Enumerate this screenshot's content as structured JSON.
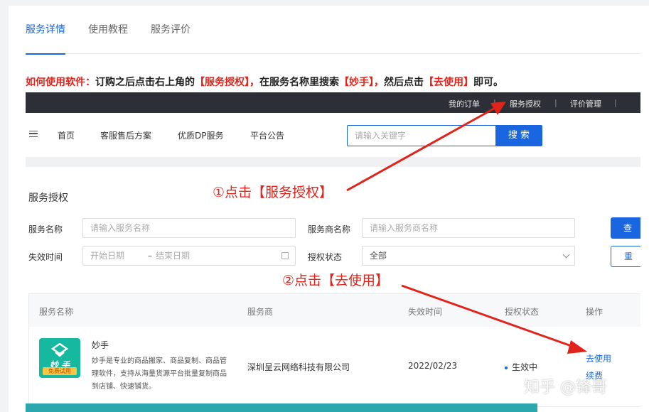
{
  "tabs": [
    {
      "label": "服务详情",
      "active": true
    },
    {
      "label": "使用教程",
      "active": false
    },
    {
      "label": "服务评价",
      "active": false
    }
  ],
  "instruction": {
    "lead": "如何使用软件：",
    "t1": "订购之后点击右上角的",
    "h1": "【服务授权】，",
    "t2": "在服务名称里搜索",
    "h2": "【妙手】，",
    "t3": "然后点击",
    "h3": "【去使用】",
    "t4": "即可。"
  },
  "topbar": {
    "my_orders": "我的订单",
    "service_auth": "服务授权",
    "review_mgmt": "评价管理",
    "sep": "|"
  },
  "nav": {
    "items": [
      "首页",
      "客服售后方案",
      "优质DP服务",
      "平台公告"
    ],
    "search_placeholder": "请输入关键字",
    "search_button": "搜 索"
  },
  "auth": {
    "title": "服务授权",
    "service_name_label": "服务名称",
    "service_name_placeholder": "请输入服务名称",
    "provider_label": "服务商名称",
    "provider_placeholder": "请输入服务商名称",
    "expiry_label": "失效时间",
    "start_placeholder": "开始日期",
    "range_sep": "–",
    "end_placeholder": "结束日期",
    "status_label": "授权状态",
    "status_value": "全部",
    "query_button": "查",
    "reset_button": "重"
  },
  "table": {
    "headers": [
      "服务名称",
      "服务商",
      "失效时间",
      "授权状态",
      "操作"
    ],
    "rows": [
      {
        "name": "妙手",
        "logo_text": "妙 手",
        "logo_badge": "免费试用",
        "desc": "妙手是专业的商品搬家、商品复制、商品管理软件，支持从海量货源平台批量复制商品到店铺、快速铺货。",
        "provider": "深圳呈云网络科技有限公司",
        "expiry": "2022/02/23",
        "status": "生效中",
        "actions": [
          "去使用",
          "续费"
        ]
      }
    ]
  },
  "annotations": {
    "step1": "①点击【服务授权】",
    "step2": "②点击【去使用】"
  },
  "watermark": "知乎 @锋哥",
  "colors": {
    "primary": "#1a66e0",
    "highlight_red": "#e0241c",
    "topbar_bg": "#2c2f36",
    "logo_teal": "#17b8a0",
    "badge_yellow": "#f7c744",
    "bottom_bar": "#2ba8ad"
  }
}
